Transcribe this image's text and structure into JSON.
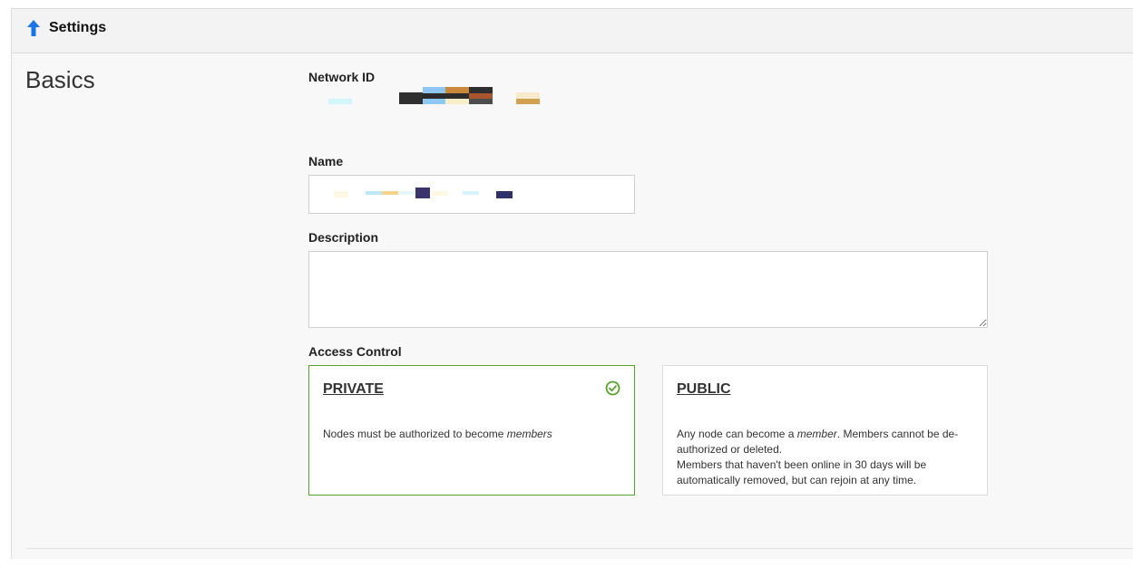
{
  "header": {
    "title": "Settings",
    "collapse_icon": "arrow-up-icon",
    "icon_color": "#1a73e8"
  },
  "section": {
    "title": "Basics"
  },
  "fields": {
    "network_id_label": "Network ID",
    "name_label": "Name",
    "description_label": "Description",
    "description_value": "",
    "access_control_label": "Access Control"
  },
  "access_control": {
    "private": {
      "title": "PRIVATE",
      "desc_pre": "Nodes must be authorized to become ",
      "desc_em": "members",
      "selected": true,
      "icon": "check-circle-icon",
      "accent": "#5aa02c"
    },
    "public": {
      "title": "PUBLIC",
      "desc_pre": "Any node can become a ",
      "desc_em": "member",
      "desc_post": ". Members cannot be de-authorized or deleted.",
      "desc_line2": "Members that haven't been online in 30 days will be automatically removed, but can rejoin at any time.",
      "selected": false
    }
  }
}
